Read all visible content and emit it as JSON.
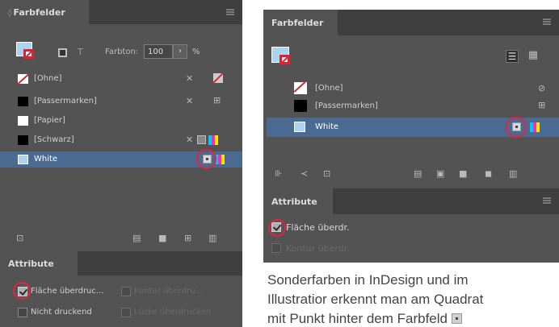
{
  "left_panel": {
    "swatches_tab": "Farbfelder",
    "tint_label": "Farbton:",
    "tint_value": "100",
    "tint_unit": "%",
    "t_label": "T",
    "swatches": [
      {
        "label": "[Ohne]",
        "color": "none"
      },
      {
        "label": "[Passermarken]",
        "color": "#000000"
      },
      {
        "label": "[Papier]",
        "color": "#ffffff"
      },
      {
        "label": "[Schwarz]",
        "color": "#000000"
      },
      {
        "label": "White",
        "color": "#a9d4f2",
        "selected": true
      }
    ],
    "attribute_tab": "Attribute",
    "options": [
      {
        "label": "Fläche überdruc...",
        "checked": true
      },
      {
        "label": "Kontur überdru...",
        "checked": false,
        "disabled": true
      },
      {
        "label": "Nicht druckend",
        "checked": false
      },
      {
        "label": "Lücke überdrucken",
        "checked": false,
        "disabled": true
      }
    ]
  },
  "right_panel": {
    "swatches_tab": "Farbfelder",
    "swatches": [
      {
        "label": "[Ohne]",
        "color": "none"
      },
      {
        "label": "[Passermarken]",
        "color": "#000000"
      },
      {
        "label": "White",
        "color": "#a9d4f2",
        "selected": true
      }
    ],
    "attribute_tab": "Attribute",
    "options": [
      {
        "label": "Fläche überdr.",
        "checked": true
      },
      {
        "label": "Kontur überdr.",
        "checked": false,
        "disabled": true
      }
    ]
  },
  "caption": {
    "line1": "Sonderfarben in InDesign und im",
    "line2": "Illustratior erkennt man am Quadrat",
    "line3": "mit Punkt hinter dem Farbfeld"
  },
  "colors": {
    "panel_bg": "#535353",
    "tab_bar": "#3f3f3f",
    "selection": "#4b6a92",
    "highlight_ring": "#e0263f"
  }
}
